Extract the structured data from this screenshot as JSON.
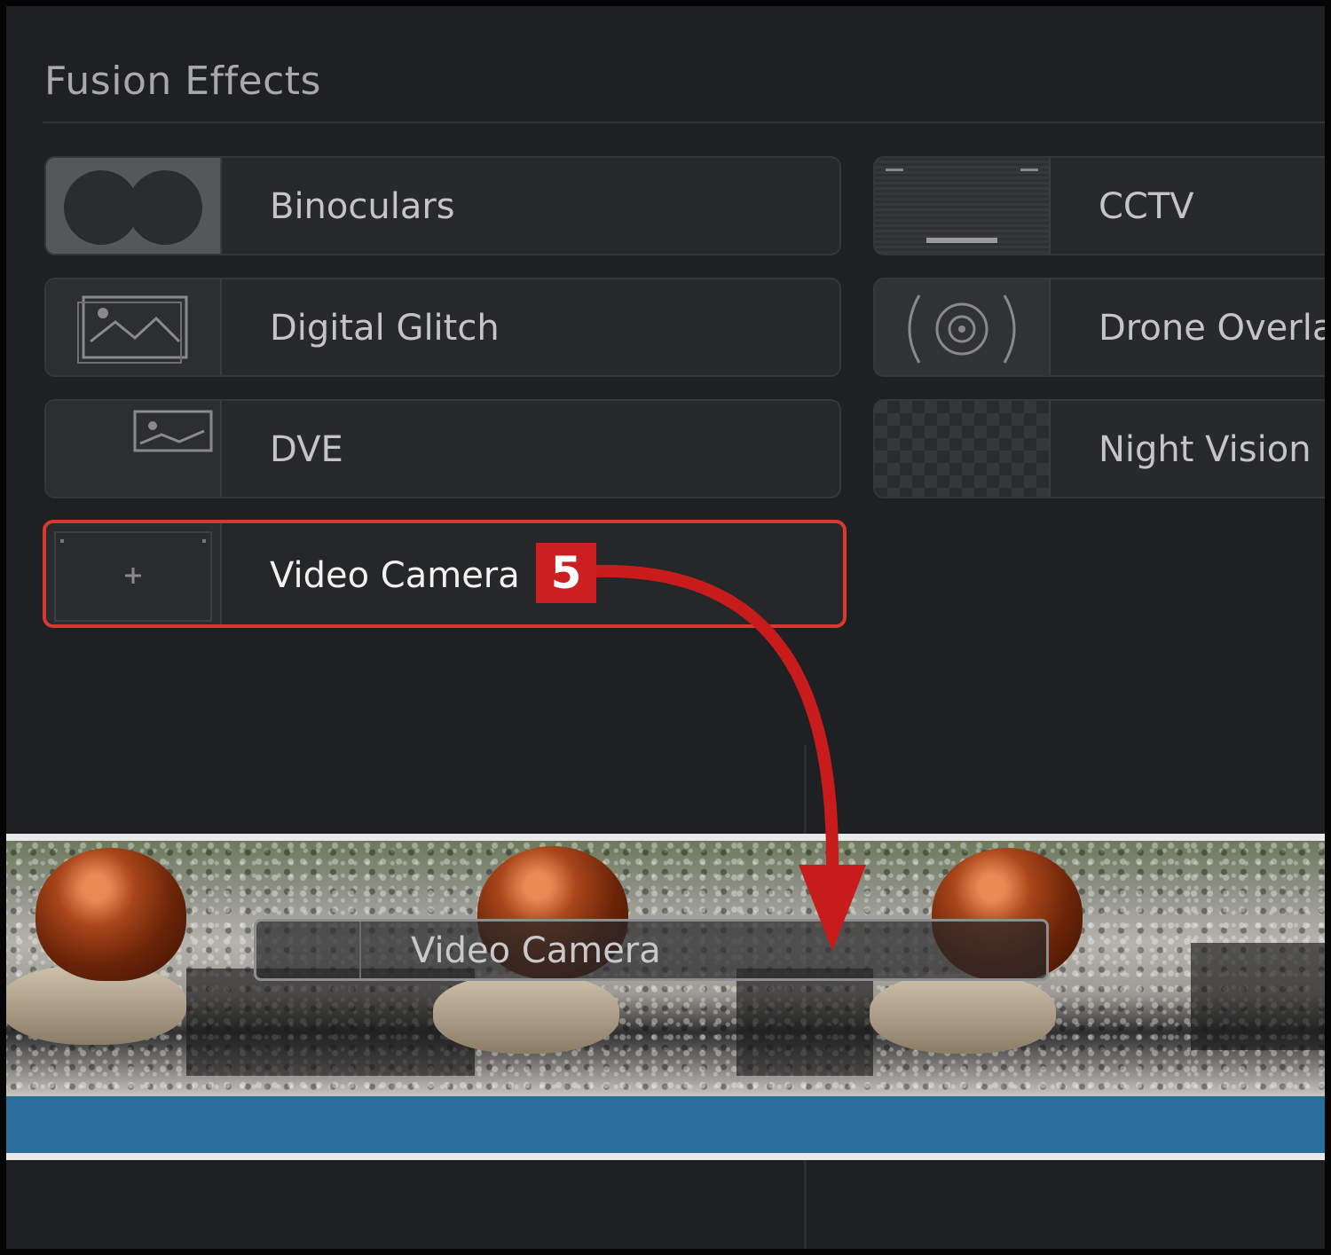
{
  "panel": {
    "title": "Fusion Effects"
  },
  "effects": [
    {
      "label": "Binoculars",
      "thumb_icon": "binoculars-mask-icon"
    },
    {
      "label": "CCTV",
      "thumb_icon": "cctv-frame-icon"
    },
    {
      "label": "Digital Glitch",
      "thumb_icon": "glitch-image-icon"
    },
    {
      "label": "Drone Overla",
      "thumb_icon": "drone-reticle-icon"
    },
    {
      "label": "DVE",
      "thumb_icon": "image-frame-icon"
    },
    {
      "label": "Night Vision",
      "thumb_icon": "pixel-noise-icon"
    },
    {
      "label": "Video Camera",
      "thumb_icon": "camera-viewfinder-icon",
      "selected": true
    }
  ],
  "step_badge": "5",
  "timeline": {
    "applied_effect_label": "Video Camera"
  },
  "colors": {
    "accent_red": "#cc1f1f",
    "highlight_border": "#d8392f",
    "audio_track": "#2a6f9b",
    "panel_bg": "#1f2024"
  }
}
